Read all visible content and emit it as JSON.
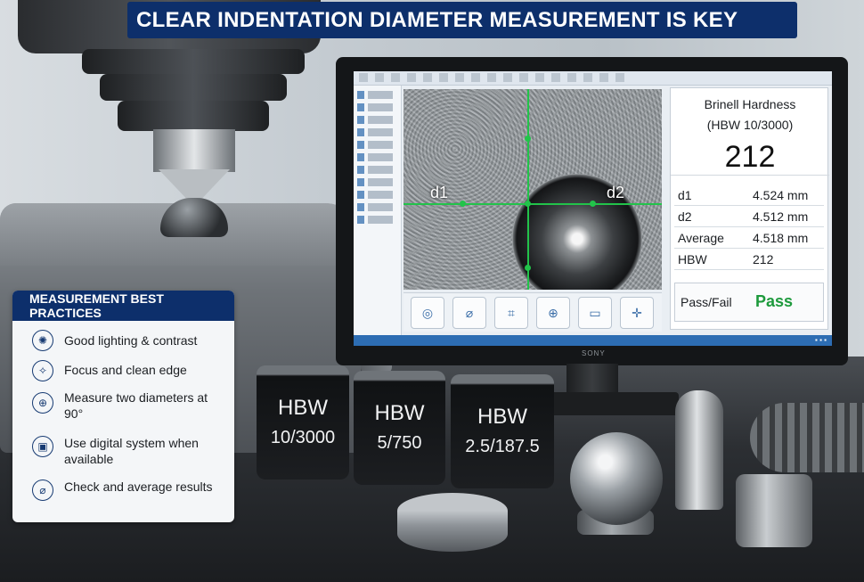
{
  "title": "CLEAR INDENTATION DIAMETER MEASUREMENT IS KEY",
  "monitor": {
    "brand": "SONY",
    "image_labels": {
      "d1": "d1",
      "d2": "d2"
    },
    "results": {
      "heading_line1": "Brinell Hardness",
      "heading_line2": "(HBW 10/3000)",
      "value": "212",
      "rows": [
        {
          "label": "d1",
          "value": "4.524 mm"
        },
        {
          "label": "d2",
          "value": "4.512 mm"
        },
        {
          "label": "Average",
          "value": "4.518 mm"
        },
        {
          "label": "HBW",
          "value": "212"
        }
      ],
      "pass_fail_label": "Pass/Fail",
      "pass_fail_value": "Pass"
    },
    "tools": [
      "circle-measure-icon",
      "diameter-icon",
      "crop-icon",
      "target-icon",
      "scale-icon",
      "crosshair-icon"
    ],
    "accent_color": "#22c34a",
    "pass_color": "#1d9a3c"
  },
  "best_practices": {
    "heading": "MEASUREMENT BEST PRACTICES",
    "items": [
      {
        "icon": "lighting-icon",
        "text": "Good lighting & contrast"
      },
      {
        "icon": "focus-icon",
        "text": "Focus and clean edge"
      },
      {
        "icon": "diameter-90-icon",
        "text": "Measure two diameters at 90°"
      },
      {
        "icon": "digital-system-icon",
        "text": "Use digital system when available"
      },
      {
        "icon": "average-icon",
        "text": "Check and average results"
      }
    ]
  },
  "test_blocks": [
    {
      "line1": "HBW",
      "line2": "10/3000"
    },
    {
      "line1": "HBW",
      "line2": "5/750"
    },
    {
      "line1": "HBW",
      "line2": "2.5/187.5"
    }
  ],
  "colors": {
    "brand_navy": "#0d2f6b"
  }
}
